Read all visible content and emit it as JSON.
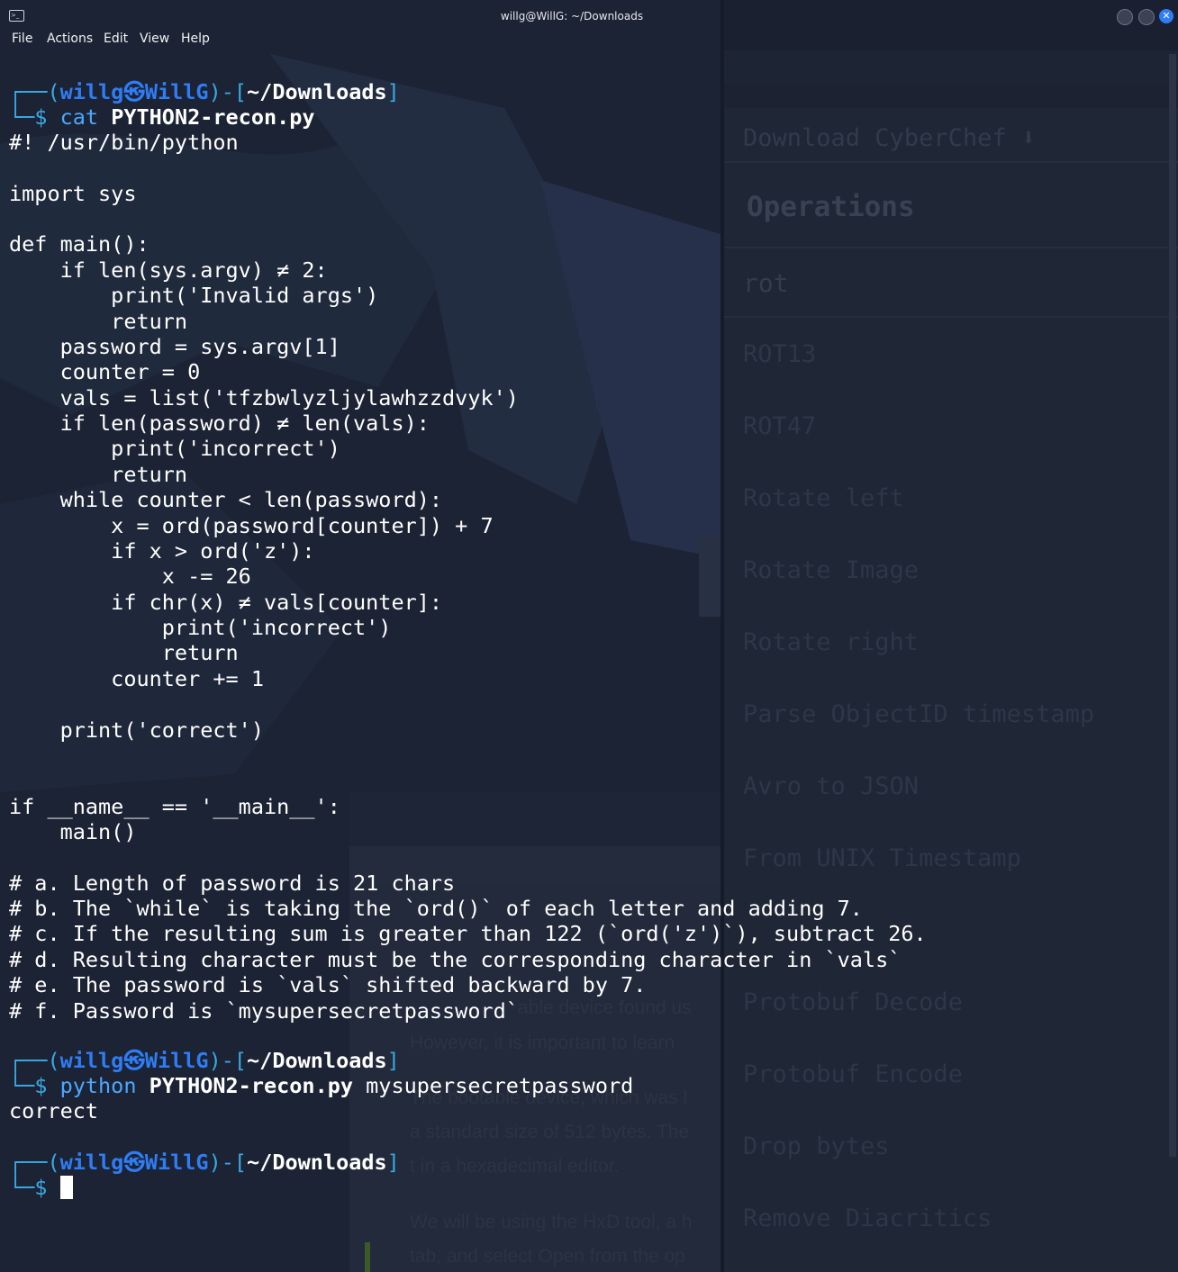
{
  "window": {
    "title": "willg@WillG: ~/Downloads",
    "menu": [
      "File",
      "Actions",
      "Edit",
      "View",
      "Help"
    ],
    "controls": [
      "minimize",
      "maximize",
      "close"
    ]
  },
  "background": {
    "download_label": "Download CyberChef",
    "operations_title": "Operations",
    "search_value": "rot",
    "operations": [
      "ROT13",
      "ROT47",
      "Rotate left",
      "Rotate Image",
      "Rotate right",
      "Parse ObjectID timestamp",
      "Avro to JSON",
      "From UNIX Timestamp",
      "Protobuf Decode",
      "Protobuf Encode",
      "Drop bytes",
      "Remove Diacritics"
    ],
    "article_lines": [
      "able device found us",
      "However, it is important to learn",
      "The bootable device, which was l",
      "a standard size of 512 bytes. The",
      "t in a hexadecimal editor.",
      "We will be using the HxD tool, a h",
      "tab, and select Open from the op"
    ]
  },
  "prompt": {
    "open": "┌──(",
    "user_host": "willg㉿WillG",
    "mid": ")-[",
    "cwd": "~/Downloads",
    "close": "]",
    "arrow": "└─$ "
  },
  "session": {
    "cmd1_name": "cat",
    "cmd1_arg": "PYTHON2-recon.py",
    "file_lines": [
      "#! /usr/bin/python",
      "",
      "import sys",
      "",
      "def main():",
      "    if len(sys.argv) ≠ 2:",
      "        print('Invalid args')",
      "        return",
      "    password = sys.argv[1]",
      "    counter = 0",
      "    vals = list('tfzbwlyzljylawhzzdvyk')",
      "    if len(password) ≠ len(vals):",
      "        print('incorrect')",
      "        return",
      "    while counter < len(password):",
      "        x = ord(password[counter]) + 7",
      "        if x > ord('z'):",
      "            x -= 26",
      "        if chr(x) ≠ vals[counter]:",
      "            print('incorrect')",
      "            return",
      "        counter += 1",
      "",
      "    print('correct')",
      "",
      "",
      "if __name__ == '__main__':",
      "    main()",
      "",
      "# a. Length of password is 21 chars",
      "# b. The `while` is taking the `ord()` of each letter and adding 7.",
      "# c. If the resulting sum is greater than 122 (`ord('z')`), subtract 26.",
      "# d. Resulting character must be the corresponding character in `vals`",
      "# e. The password is `vals` shifted backward by 7.",
      "# f. Password is `mysupersecretpassword`"
    ],
    "cmd2_name": "python",
    "cmd2_arg": "PYTHON2-recon.py",
    "cmd2_extra": " mysupersecretpassword",
    "output": "correct"
  }
}
